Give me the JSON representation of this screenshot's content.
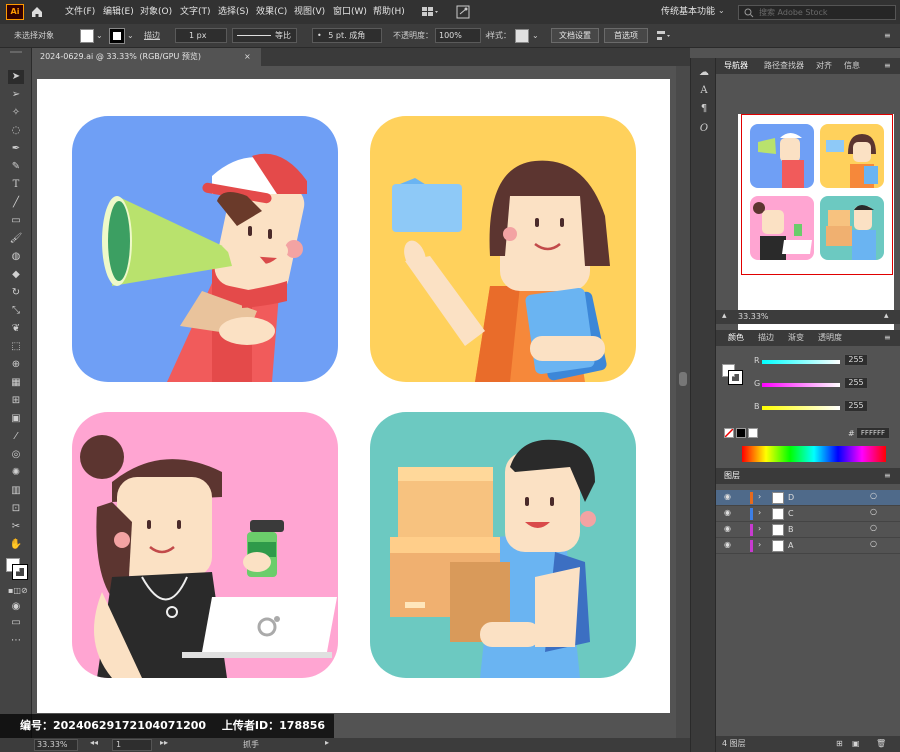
{
  "app": {
    "logo": "Ai",
    "workspace": "传统基本功能",
    "search_placeholder": "搜索 Adobe Stock"
  },
  "menu": [
    "文件(F)",
    "编辑(E)",
    "对象(O)",
    "文字(T)",
    "选择(S)",
    "效果(C)",
    "视图(V)",
    "窗口(W)",
    "帮助(H)"
  ],
  "control_bar": {
    "selection": "未选择对象",
    "stroke_label": "描边",
    "stroke_value": "1 px",
    "stroke_style": "等比",
    "brush": "5 pt. 成角",
    "opacity_label": "不透明度：",
    "opacity_value": "100%",
    "style_label": "样式：",
    "doc_setup": "文档设置",
    "prefs": "首选项"
  },
  "document_tab": "2024-0629.ai @ 33.33% (RGB/GPU 预览)",
  "status_bar": {
    "zoom": "33.33%",
    "artboard": "1",
    "tool": "抓手"
  },
  "panels": {
    "navigator_tabs": [
      "导航器",
      "路径查找器",
      "对齐",
      "信息"
    ],
    "nav_zoom": "33.33%",
    "color_tabs": [
      "颜色",
      "描边",
      "渐变",
      "透明度"
    ],
    "color": {
      "r": "255",
      "g": "255",
      "b": "255",
      "r_label": "R",
      "g_label": "G",
      "b_label": "B",
      "hex_label": "#",
      "hex": "FFFFFF"
    },
    "layers_title": "图层",
    "layers": [
      {
        "name": "D",
        "color": "#e66a1e"
      },
      {
        "name": "C",
        "color": "#3d7fe6"
      },
      {
        "name": "B",
        "color": "#c83ad0"
      },
      {
        "name": "A",
        "color": "#c83ad0"
      }
    ],
    "layers_count": "4 图层"
  },
  "tiles": {
    "a": "#6f9ff5",
    "b": "#ffd15c",
    "c": "#ffa5d2",
    "d": "#6cc9c1"
  },
  "watermark": {
    "id_label": "编号：",
    "id": "20240629172104071200",
    "uploader_label": "上传者ID：",
    "uploader": "178856"
  }
}
